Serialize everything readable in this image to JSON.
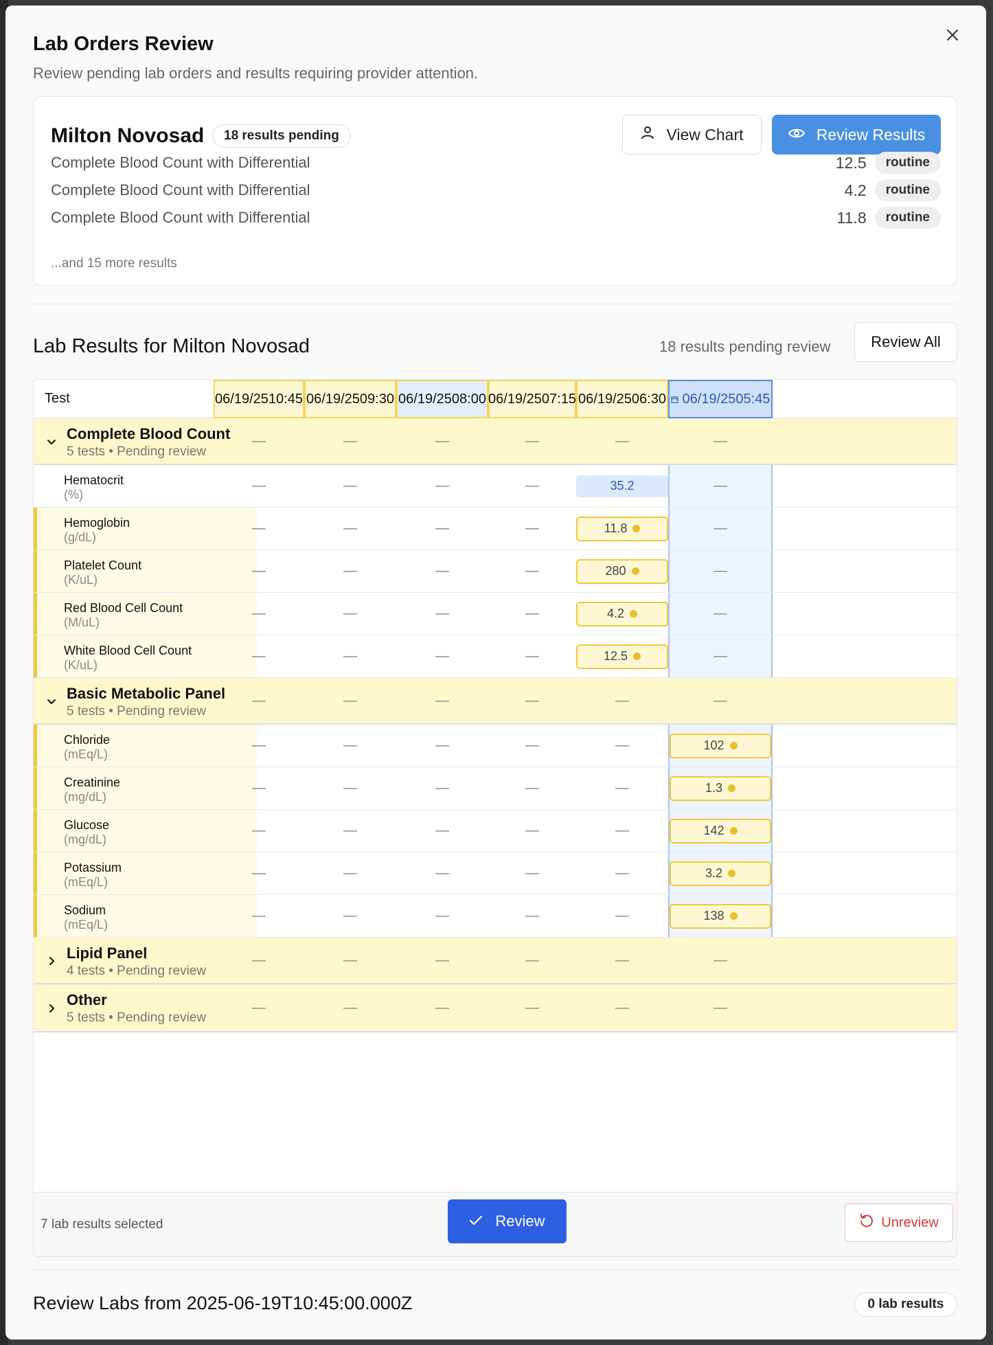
{
  "modal": {
    "title": "Lab Orders Review",
    "subtitle": "Review pending lab orders and results requiring provider attention."
  },
  "patient_card": {
    "name": "Milton Novosad",
    "pending_badge": "18 results pending",
    "view_chart": "View Chart",
    "review_results": "Review Results",
    "results": [
      {
        "name": "Complete Blood Count with Differential",
        "value": "12.5",
        "priority": "routine"
      },
      {
        "name": "Complete Blood Count with Differential",
        "value": "4.2",
        "priority": "routine"
      },
      {
        "name": "Complete Blood Count with Differential",
        "value": "11.8",
        "priority": "routine"
      }
    ],
    "more_text": "...and 15 more results"
  },
  "lab_results": {
    "title": "Lab Results for Milton Novosad",
    "pending_text": "18 results pending review",
    "review_all": "Review All",
    "header_test": "Test",
    "columns": [
      "06/19/2510:45",
      "06/19/2509:30",
      "06/19/2508:00",
      "06/19/2507:15",
      "06/19/2506:30",
      "06/19/2505:45"
    ],
    "empty": "—",
    "groups": [
      {
        "name": "Complete Blood Count",
        "sub": "5 tests • Pending review"
      },
      {
        "name": "Basic Metabolic Panel",
        "sub": "5 tests • Pending review"
      },
      {
        "name": "Lipid Panel",
        "sub": "4 tests • Pending review"
      },
      {
        "name": "Other",
        "sub": "5 tests • Pending review"
      }
    ],
    "tests": [
      {
        "name": "Hematocrit",
        "unit": "(%)",
        "value": "35.2"
      },
      {
        "name": "Hemoglobin",
        "unit": "(g/dL)",
        "value": "11.8"
      },
      {
        "name": "Platelet Count",
        "unit": "(K/uL)",
        "value": "280"
      },
      {
        "name": "Red Blood Cell Count",
        "unit": "(M/uL)",
        "value": "4.2"
      },
      {
        "name": "White Blood Cell Count",
        "unit": "(K/uL)",
        "value": "12.5"
      },
      {
        "name": "Chloride",
        "unit": "(mEq/L)",
        "value": "102"
      },
      {
        "name": "Creatinine",
        "unit": "(mg/dL)",
        "value": "1.3"
      },
      {
        "name": "Glucose",
        "unit": "(mg/dL)",
        "value": "142"
      },
      {
        "name": "Potassium",
        "unit": "(mEq/L)",
        "value": "3.2"
      },
      {
        "name": "Sodium",
        "unit": "(mEq/L)",
        "value": "138"
      }
    ],
    "footer": {
      "selected": "7 lab results selected",
      "review": "Review",
      "unreview": "Unreview"
    }
  },
  "bottom": {
    "title": "Review Labs from 2025-06-19T10:45:00.000Z",
    "count_badge": "0 lab results"
  },
  "colors": {
    "primary_blue": "#2f5fe3",
    "review_results_blue": "#4a90e2",
    "flag_yellow": "#f0c93a",
    "group_bg": "#fdf8cc",
    "unreview_red": "#d83a3a"
  }
}
